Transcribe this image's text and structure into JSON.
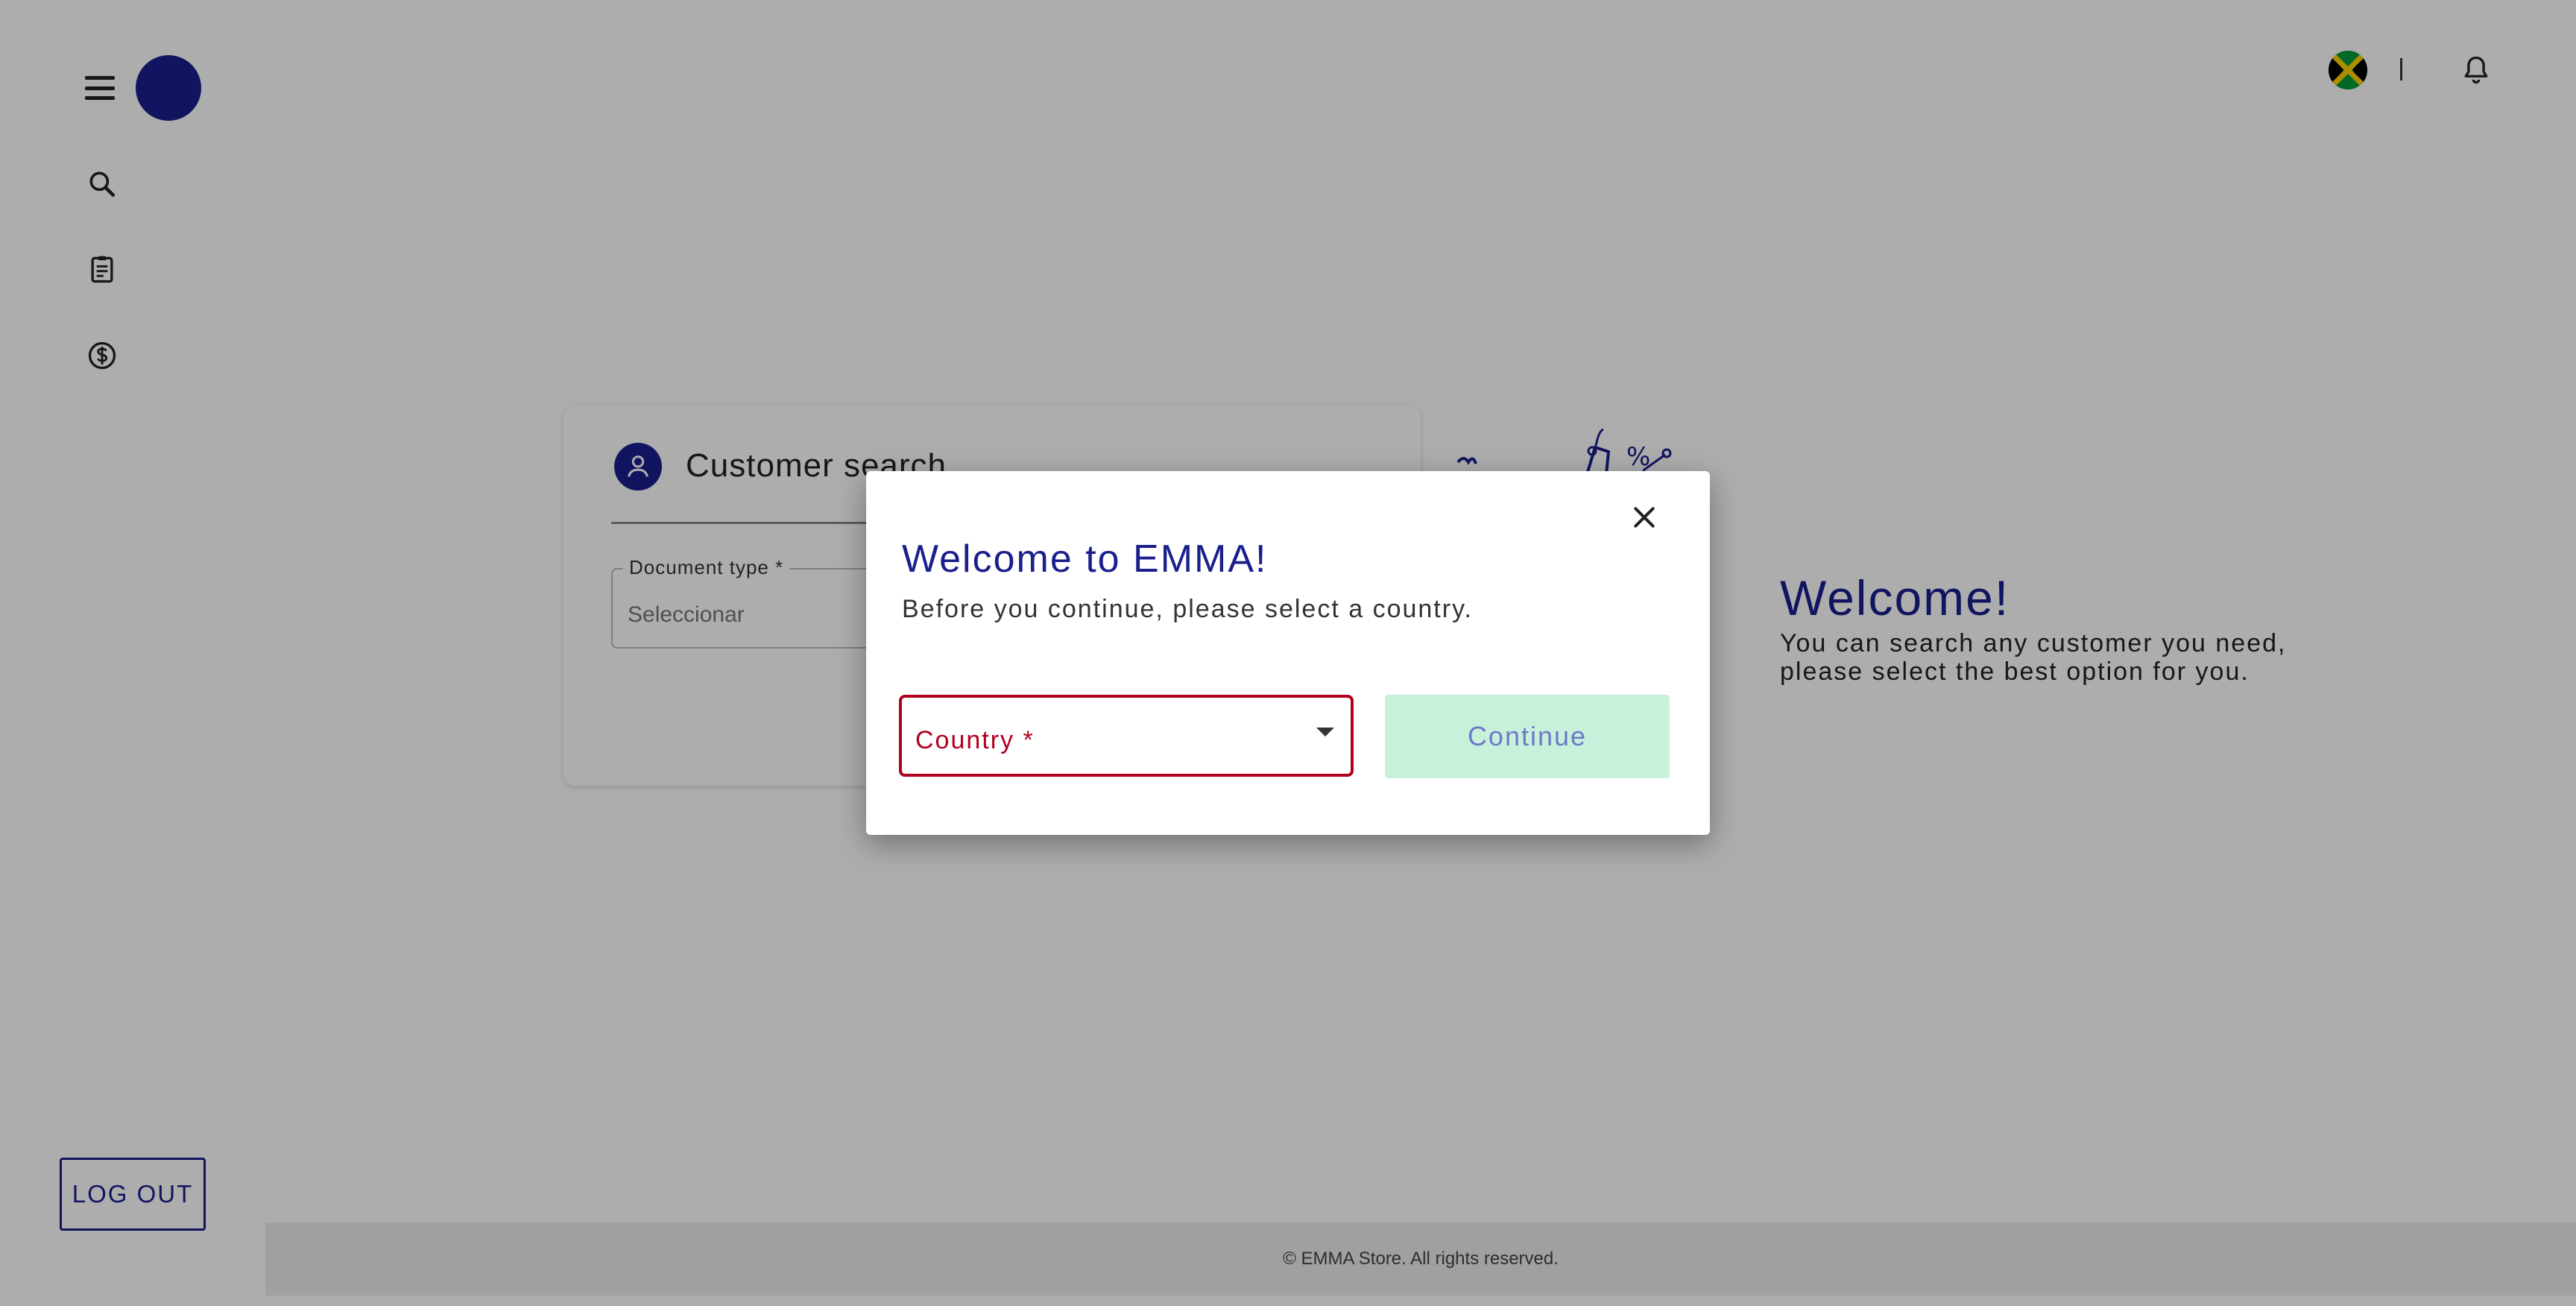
{
  "sidebar": {
    "menu_icon": "menu-icon",
    "nav_icons": [
      "search-icon",
      "clipboard-icon",
      "dollar-circle-icon"
    ],
    "logout_label": "LOG OUT"
  },
  "header": {
    "flag_icon": "jamaica-flag-icon",
    "notification_icon": "bell-icon"
  },
  "customer_search": {
    "title": "Customer search",
    "document_type": {
      "label": "Document type *",
      "value": "Seleccionar"
    }
  },
  "welcome": {
    "title": "Welcome!",
    "text": "You can search any customer you need, please select the best option for you."
  },
  "footer": {
    "text": "© EMMA Store. All rights reserved."
  },
  "modal": {
    "title": "Welcome to EMMA!",
    "subtitle": "Before you continue, please select a country.",
    "country_label": "Country *",
    "continue_label": "Continue"
  },
  "colors": {
    "brand": "#1a1f8c",
    "error": "#b00020",
    "continue_bg": "#c8f1db",
    "continue_text": "#6f78c9"
  }
}
